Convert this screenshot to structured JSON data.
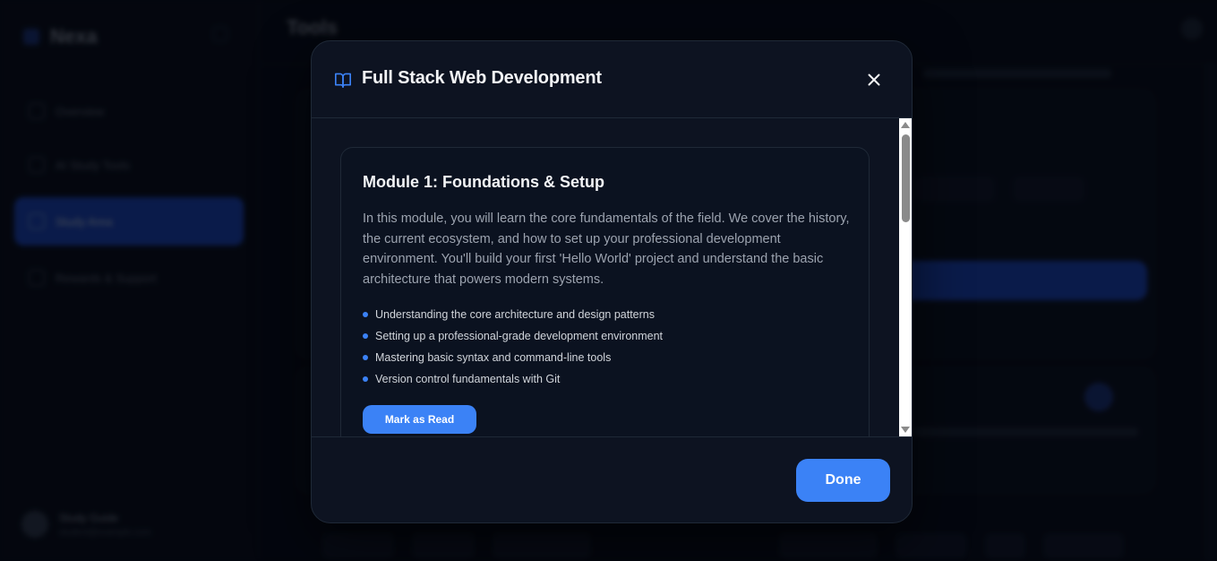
{
  "background": {
    "brand": "Nexa",
    "page_title": "Tools",
    "nav_items": [
      "Overview",
      "AI Study Tools",
      "Study Area",
      "Rewards & Support"
    ],
    "user_name": "Study Guide",
    "user_email": "student@example.com"
  },
  "modal": {
    "title": "Full Stack Web Development",
    "icon": "book-open-icon",
    "close_icon": "close-icon",
    "module": {
      "title": "Module 1: Foundations & Setup",
      "description": "In this module, you will learn the core fundamentals of the field. We cover the history, the current ecosystem, and how to set up your professional development environment. You'll build your first 'Hello World' project and understand the basic architecture that powers modern systems.",
      "topics": [
        "Understanding the core architecture and design patterns",
        "Setting up a professional-grade development environment",
        "Mastering basic syntax and command-line tools",
        "Version control fundamentals with Git"
      ],
      "mark_read_label": "Mark as Read"
    },
    "done_label": "Done"
  },
  "colors": {
    "accent": "#3b82f6",
    "modal_bg": "#0d1321",
    "card_bg": "#0b1220"
  }
}
